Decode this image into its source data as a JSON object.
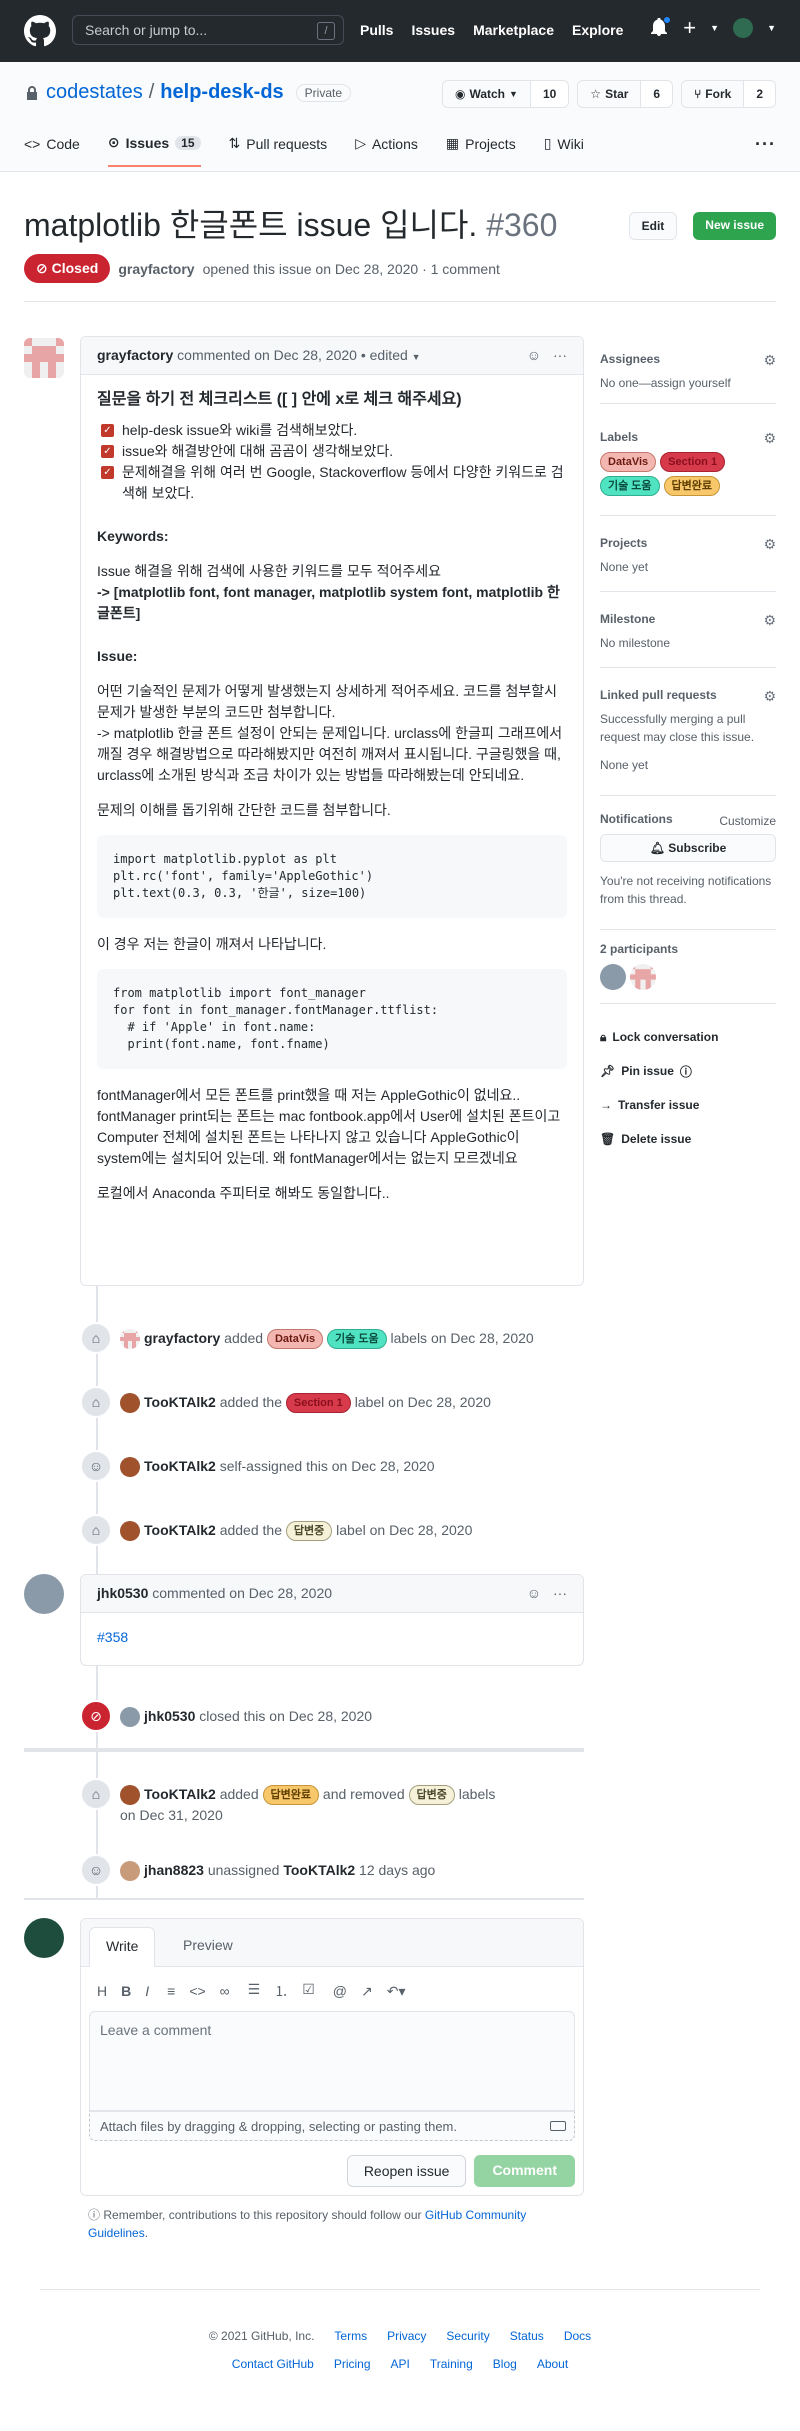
{
  "topbar": {
    "search_placeholder": "Search or jump to...",
    "search_key": "/",
    "nav": [
      "Pulls",
      "Issues",
      "Marketplace",
      "Explore"
    ]
  },
  "repo": {
    "owner": "codestates",
    "name": "help-desk-ds",
    "visibility": "Private",
    "watch_label": "Watch",
    "watch_count": "10",
    "star_label": "Star",
    "star_count": "6",
    "fork_label": "Fork",
    "fork_count": "2",
    "tabs": [
      {
        "label": "Code",
        "icon": "code-icon"
      },
      {
        "label": "Issues",
        "icon": "issue-icon",
        "count": "15"
      },
      {
        "label": "Pull requests",
        "icon": "pull-request-icon"
      },
      {
        "label": "Actions",
        "icon": "play-icon"
      },
      {
        "label": "Projects",
        "icon": "project-icon"
      },
      {
        "label": "Wiki",
        "icon": "book-icon"
      }
    ]
  },
  "issue": {
    "title": "matplotlib 한글폰트 issue 입니다.",
    "number": "#360",
    "edit_label": "Edit",
    "new_label": "New issue",
    "state": "Closed",
    "author": "grayfactory",
    "meta": "opened this issue on Dec 28, 2020 · 1 comment"
  },
  "comment1": {
    "author": "grayfactory",
    "meta": "commented on Dec 28, 2020 • edited",
    "heading": "질문을 하기 전 체크리스트 ([ ] 안에 x로 체크 해주세요)",
    "checks": [
      "help-desk issue와 wiki를 검색해보았다.",
      "issue와 해결방안에 대해 곰곰이 생각해보았다.",
      "문제해결을 위해 여러 번 Google, Stackoverflow 등에서 다양한 키워드로 검색해 보았다."
    ],
    "keywords_title": "Keywords:",
    "keywords_desc": "Issue 해결을 위해 검색에 사용한 키워드를 모두 적어주세요",
    "keywords_value": "-> [matplotlib font, font manager, matplotlib system font, matplotlib 한글폰트]",
    "issue_title": "Issue:",
    "issue_desc": "어떤 기술적인 문제가 어떻게 발생했는지 상세하게 적어주세요. 코드를 첨부할시 문제가 발생한 부분의 코드만 첨부합니다.",
    "issue_detail": "-> matplotlib 한글 폰트 설정이 안되는 문제입니다. urclass에 한글피 그래프에서 깨질 경우 해결방법으로 따라해봤지만 여전히 깨져서 표시됩니다. 구글링했을 때, urclass에 소개된 방식과 조금 차이가 있는 방법들 따라해봤는데 안되네요.",
    "code_intro": "문제의 이해를 돕기위해 간단한 코드를 첨부합니다.",
    "code1": "import matplotlib.pyplot as plt\nplt.rc('font', family='AppleGothic')\nplt.text(0.3, 0.3, '한글', size=100)",
    "after_code1": "이 경우 저는 한글이 깨져서 나타납니다.",
    "code2": "from matplotlib import font_manager\nfor font in font_manager.fontManager.ttflist:\n  # if 'Apple' in font.name:\n  print(font.name, font.fname)",
    "p_fontmanager": "fontManager에서 모든 폰트를 print했을 때 저는 AppleGothic이 없네요.. fontManager print되는 폰트는 mac fontbook.app에서 User에 설치된 폰트이고 Computer 전체에 설치된 폰트는 나타나지 않고 있습니다 AppleGothic이 system에는 설치되어 있는데. 왜 fontManager에서는 없는지 모르겠네요",
    "p_local": "로컬에서 Anaconda 주피터로 해봐도 동일합니다.."
  },
  "events": {
    "e1": {
      "actor": "grayfactory",
      "pre": "added",
      "labels": [
        "DataVis",
        "기술 도움"
      ],
      "post": "labels on Dec 28, 2020"
    },
    "e2": {
      "actor": "TooKTAlk2",
      "pre": "added the",
      "label": "Section 1",
      "post": "label on Dec 28, 2020"
    },
    "e3": {
      "actor": "TooKTAlk2",
      "text": "self-assigned this on Dec 28, 2020"
    },
    "e4": {
      "actor": "TooKTAlk2",
      "pre": "added the",
      "label": "답변중",
      "post": "label on Dec 28, 2020"
    },
    "closed": {
      "actor": "jhk0530",
      "text": "closed this on Dec 28, 2020"
    },
    "e5": {
      "actor": "TooKTAlk2",
      "pre": "added",
      "label_added": "답변완료",
      "mid": "and removed",
      "label_removed": "답변중",
      "post": "labels",
      "date": "on Dec 31, 2020"
    },
    "e6": {
      "actor": "jhan8823",
      "mid": "unassigned",
      "target": "TooKTAlk2",
      "post": "12 days ago"
    }
  },
  "comment2": {
    "author": "jhk0530",
    "meta": "commented on Dec 28, 2020",
    "link": "#358"
  },
  "form": {
    "tab_write": "Write",
    "tab_preview": "Preview",
    "placeholder": "Leave a comment",
    "attach": "Attach files by dragging & dropping, selecting or pasting them.",
    "reopen": "Reopen issue",
    "comment": "Comment",
    "remember_pre": "Remember, contributions to this repository should follow our",
    "remember_link": "GitHub Community Guidelines",
    "remember_post": "."
  },
  "sidebar": {
    "assignees_title": "Assignees",
    "assignees_text": "No one—assign yourself",
    "labels_title": "Labels",
    "labels": [
      "DataVis",
      "Section 1",
      "기술 도움",
      "답변완료"
    ],
    "projects_title": "Projects",
    "projects_text": "None yet",
    "milestone_title": "Milestone",
    "milestone_text": "No milestone",
    "linked_title": "Linked pull requests",
    "linked_text": "Successfully merging a pull request may close this issue.",
    "linked_none": "None yet",
    "notifications_title": "Notifications",
    "customize": "Customize",
    "subscribe": "Subscribe",
    "notif_text": "You're not receiving notifications from this thread.",
    "participants": "2 participants",
    "lock": "Lock conversation",
    "pin": "Pin issue",
    "transfer": "Transfer issue",
    "delete": "Delete issue"
  },
  "footer": {
    "copyright": "© 2021 GitHub, Inc.",
    "row1": [
      "Terms",
      "Privacy",
      "Security",
      "Status",
      "Docs"
    ],
    "row2": [
      "Contact GitHub",
      "Pricing",
      "API",
      "Training",
      "Blog",
      "About"
    ]
  },
  "colors": {
    "closed_red": "#cb2431",
    "new_issue_green": "#2ea44f",
    "link_blue": "#0366d6"
  }
}
